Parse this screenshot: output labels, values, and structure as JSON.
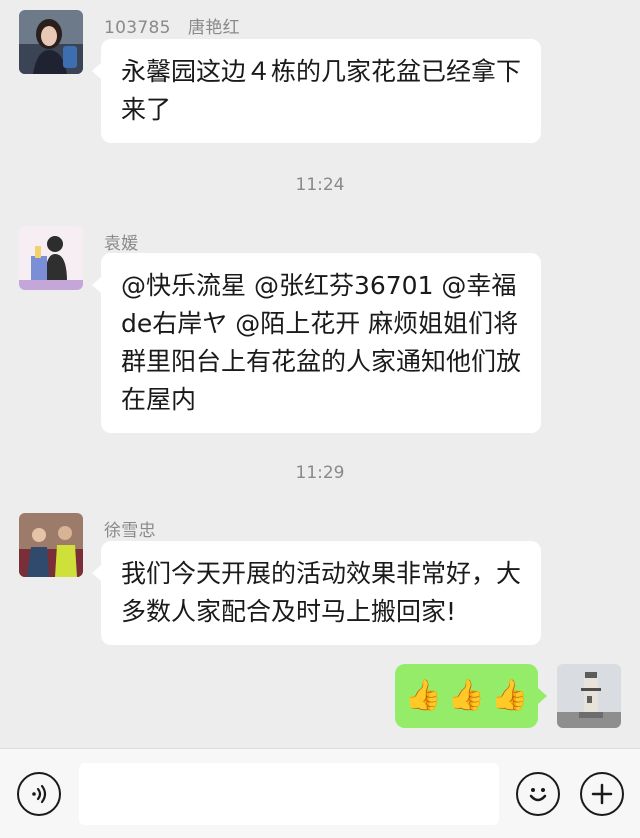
{
  "messages": [
    {
      "sender": "103785　唐艳红",
      "text": "永馨园这边４栋的几家花盆已经拿下来了"
    },
    {
      "timestamp": "11:24",
      "sender": "袁媛",
      "text": "@快乐流星 @张红芬36701 @幸福de右岸ヤ @陌上花开 麻烦姐姐们将群里阳台上有花盆的人家通知他们放在屋内"
    },
    {
      "timestamp": "11:29",
      "sender": "徐雪忠",
      "text": "我们今天开展的活动效果非常好，大多数人家配合及时马上搬回家!"
    }
  ],
  "my_message": {
    "emojis": [
      "👍",
      "👍",
      "👍"
    ]
  },
  "input_bar": {
    "voice_icon": "voice-icon",
    "emoji_icon": "emoji-icon",
    "plus_icon": "plus-icon"
  },
  "colors": {
    "background": "#ededed",
    "bubble_incoming": "#ffffff",
    "bubble_outgoing": "#95ec69",
    "meta_text": "#8a8a8a"
  }
}
